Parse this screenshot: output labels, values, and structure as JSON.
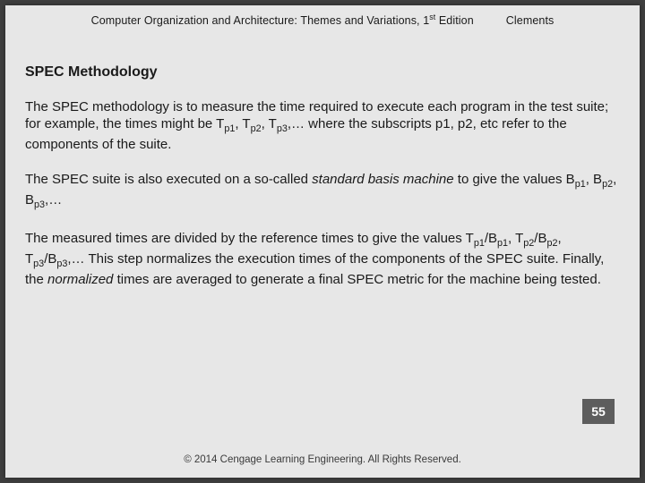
{
  "header": {
    "book_title_prefix": "Computer Organization and Architecture: Themes and Variations, 1",
    "edition_sup": "st",
    "book_title_suffix": " Edition",
    "author": "Clements"
  },
  "title": "SPEC Methodology",
  "p1": {
    "a": "The SPEC methodology is to measure the time required to execute each program in the test suite; for example, the times might be T",
    "s1": "p1",
    "b": ", T",
    "s2": "p2",
    "c": ", T",
    "s3": "p3",
    "d": ",… where the subscripts p1, p2, etc refer to the components of the suite."
  },
  "p2": {
    "a": "The SPEC suite is also executed on a so-called ",
    "em": "standard basis machine",
    "b": " to give the values B",
    "s1": "p1",
    "c": ", B",
    "s2": "p2",
    "d": ", B",
    "s3": "p3",
    "e": ",…"
  },
  "p3": {
    "a": "The measured times are divided by the reference times to give the values T",
    "s1": "p1",
    "b": "/B",
    "s2": "p1",
    "c": ", T",
    "s3": "p2",
    "d": "/B",
    "s4": "p2",
    "e": ", T",
    "s5": "p3",
    "f": "/B",
    "s6": "p3",
    "g": ",… This step normalizes the execution times of the components of the SPEC suite. Finally, the ",
    "em": "normalized",
    "h": " times are averaged to generate a final SPEC metric for the machine being tested."
  },
  "page_number": "55",
  "copyright": "© 2014 Cengage Learning Engineering. All Rights Reserved."
}
